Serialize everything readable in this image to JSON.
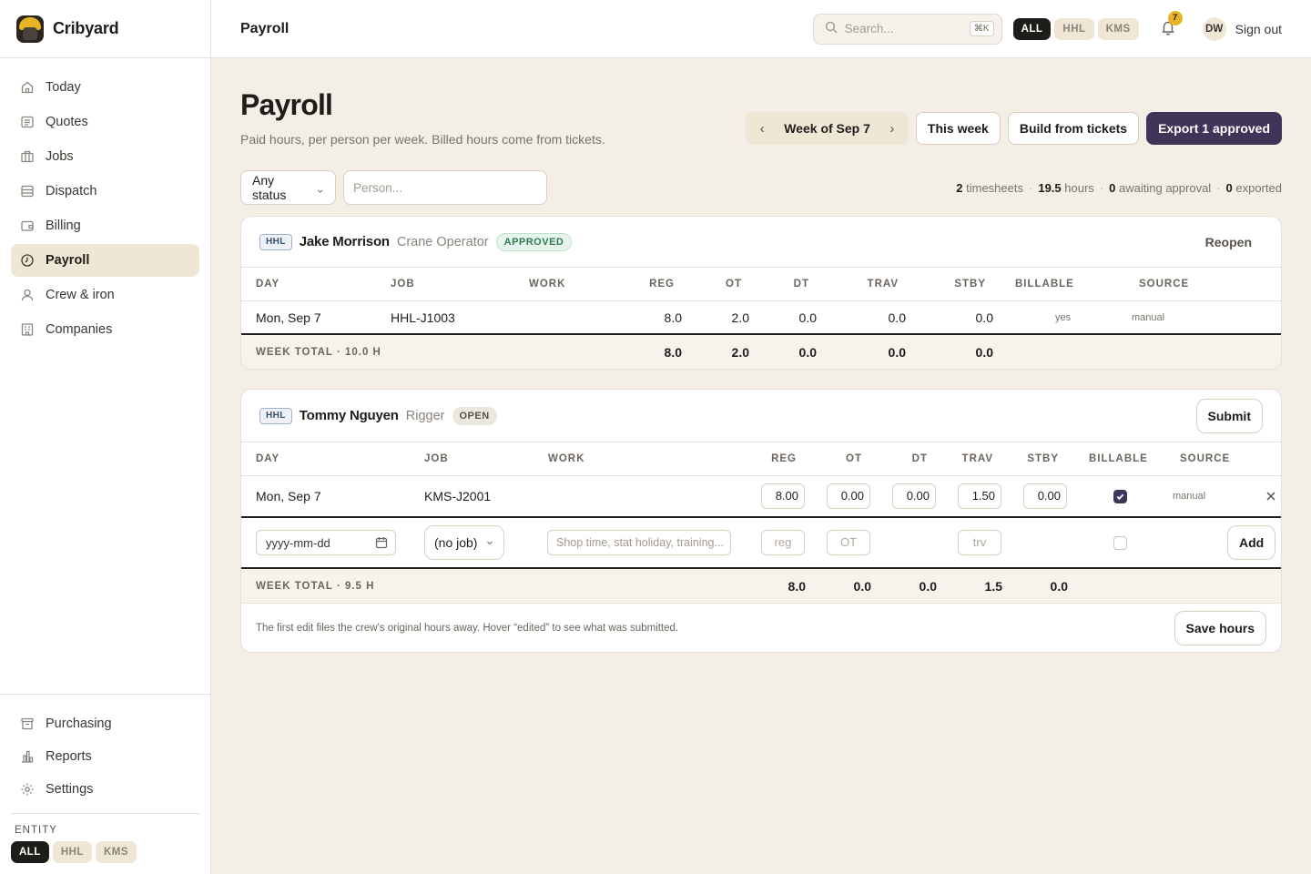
{
  "brand": {
    "name": "Cribyard"
  },
  "nav": {
    "items": [
      {
        "label": "Today",
        "icon": "home-icon"
      },
      {
        "label": "Quotes",
        "icon": "document-icon"
      },
      {
        "label": "Jobs",
        "icon": "building-icon"
      },
      {
        "label": "Dispatch",
        "icon": "list-icon"
      },
      {
        "label": "Billing",
        "icon": "wallet-icon"
      },
      {
        "label": "Payroll",
        "icon": "clock-icon",
        "active": true
      },
      {
        "label": "Crew & iron",
        "icon": "user-icon"
      },
      {
        "label": "Companies",
        "icon": "office-icon"
      }
    ],
    "bottom": [
      {
        "label": "Purchasing",
        "icon": "archive-icon"
      },
      {
        "label": "Reports",
        "icon": "chart-icon"
      },
      {
        "label": "Settings",
        "icon": "gear-icon"
      }
    ],
    "entity_label": "ENTITY",
    "entity_pills": [
      "ALL",
      "HHL",
      "KMS"
    ]
  },
  "topbar": {
    "title": "Payroll",
    "search_placeholder": "Search...",
    "search_shortcut": "⌘K",
    "entity_pills": [
      "ALL",
      "HHL",
      "KMS"
    ],
    "notifications": "7",
    "avatar": "DW",
    "signout": "Sign out"
  },
  "page": {
    "title": "Payroll",
    "subtitle": "Paid hours, per person per week. Billed hours come from tickets.",
    "week_prev": "‹",
    "week_label": "Week of Sep 7",
    "week_next": "›",
    "this_week": "This week",
    "build": "Build from tickets",
    "export": "Export 1 approved"
  },
  "filters": {
    "status": "Any status",
    "person_placeholder": "Person..."
  },
  "stats": {
    "timesheets_count": "2",
    "timesheets_label": "timesheets",
    "hours_count": "19.5",
    "hours_label": "hours",
    "awaiting_count": "0",
    "awaiting_label": "awaiting approval",
    "exported_count": "0",
    "exported_label": "exported"
  },
  "columns": {
    "day": "DAY",
    "job": "JOB",
    "work": "WORK",
    "reg": "REG",
    "ot": "OT",
    "dt": "DT",
    "trav": "TRAV",
    "stby": "STBY",
    "billable": "BILLABLE",
    "source": "SOURCE"
  },
  "sheets": [
    {
      "entity": "HHL",
      "name": "Jake Morrison",
      "role": "Crane Operator",
      "status": "APPROVED",
      "action": "Reopen",
      "row": {
        "day": "Mon, Sep 7",
        "job": "HHL-J1003",
        "work": "",
        "reg": "8.0",
        "ot": "2.0",
        "dt": "0.0",
        "trav": "0.0",
        "stby": "0.0",
        "billable": "yes",
        "source": "manual"
      },
      "total_label": "WEEK TOTAL · 10.0 H",
      "totals": {
        "reg": "8.0",
        "ot": "2.0",
        "dt": "0.0",
        "trav": "0.0",
        "stby": "0.0"
      }
    },
    {
      "entity": "HHL",
      "name": "Tommy Nguyen",
      "role": "Rigger",
      "status": "OPEN",
      "action": "Submit",
      "row": {
        "day": "Mon, Sep 7",
        "job": "KMS-J2001",
        "work": "",
        "reg": "8.00",
        "ot": "0.00",
        "dt": "0.00",
        "trav": "1.50",
        "stby": "0.00",
        "billable": true,
        "source": "manual"
      },
      "new_row": {
        "date_placeholder": "yyyy-mm-dd",
        "job": "(no job)",
        "work_placeholder": "Shop time, stat holiday, training...",
        "reg_placeholder": "reg",
        "ot_placeholder": "OT",
        "trav_placeholder": "trv",
        "add": "Add"
      },
      "total_label": "WEEK TOTAL · 9.5 H",
      "totals": {
        "reg": "8.0",
        "ot": "0.0",
        "dt": "0.0",
        "trav": "1.5",
        "stby": "0.0"
      },
      "note": "The first edit files the crew's original hours away. Hover “edited” to see what was submitted.",
      "save": "Save hours"
    }
  ],
  "colors": {
    "accent": "#3f3559",
    "approved": "#2f7a4f",
    "badge": "#e8b424",
    "background": "#f3eee6"
  }
}
